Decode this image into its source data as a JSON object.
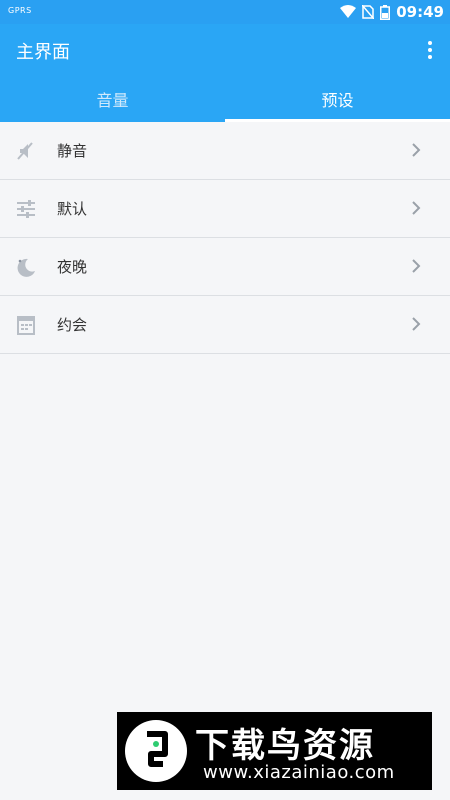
{
  "status_bar": {
    "carrier": "GPRS",
    "time": "09:49"
  },
  "app_bar": {
    "title": "主界面"
  },
  "tabs": [
    {
      "label": "音量",
      "active": false
    },
    {
      "label": "预设",
      "active": true
    }
  ],
  "presets": [
    {
      "label": "静音",
      "icon": "mute-icon"
    },
    {
      "label": "默认",
      "icon": "sliders-icon"
    },
    {
      "label": "夜晚",
      "icon": "moon-icon"
    },
    {
      "label": "约会",
      "icon": "calendar-icon"
    }
  ],
  "watermark": {
    "title": "下载鸟资源",
    "url": "www.xiazainiao.com"
  },
  "colors": {
    "primary": "#2aa6f5",
    "status_bar": "#2aa0f2",
    "background": "#f5f6f8"
  }
}
